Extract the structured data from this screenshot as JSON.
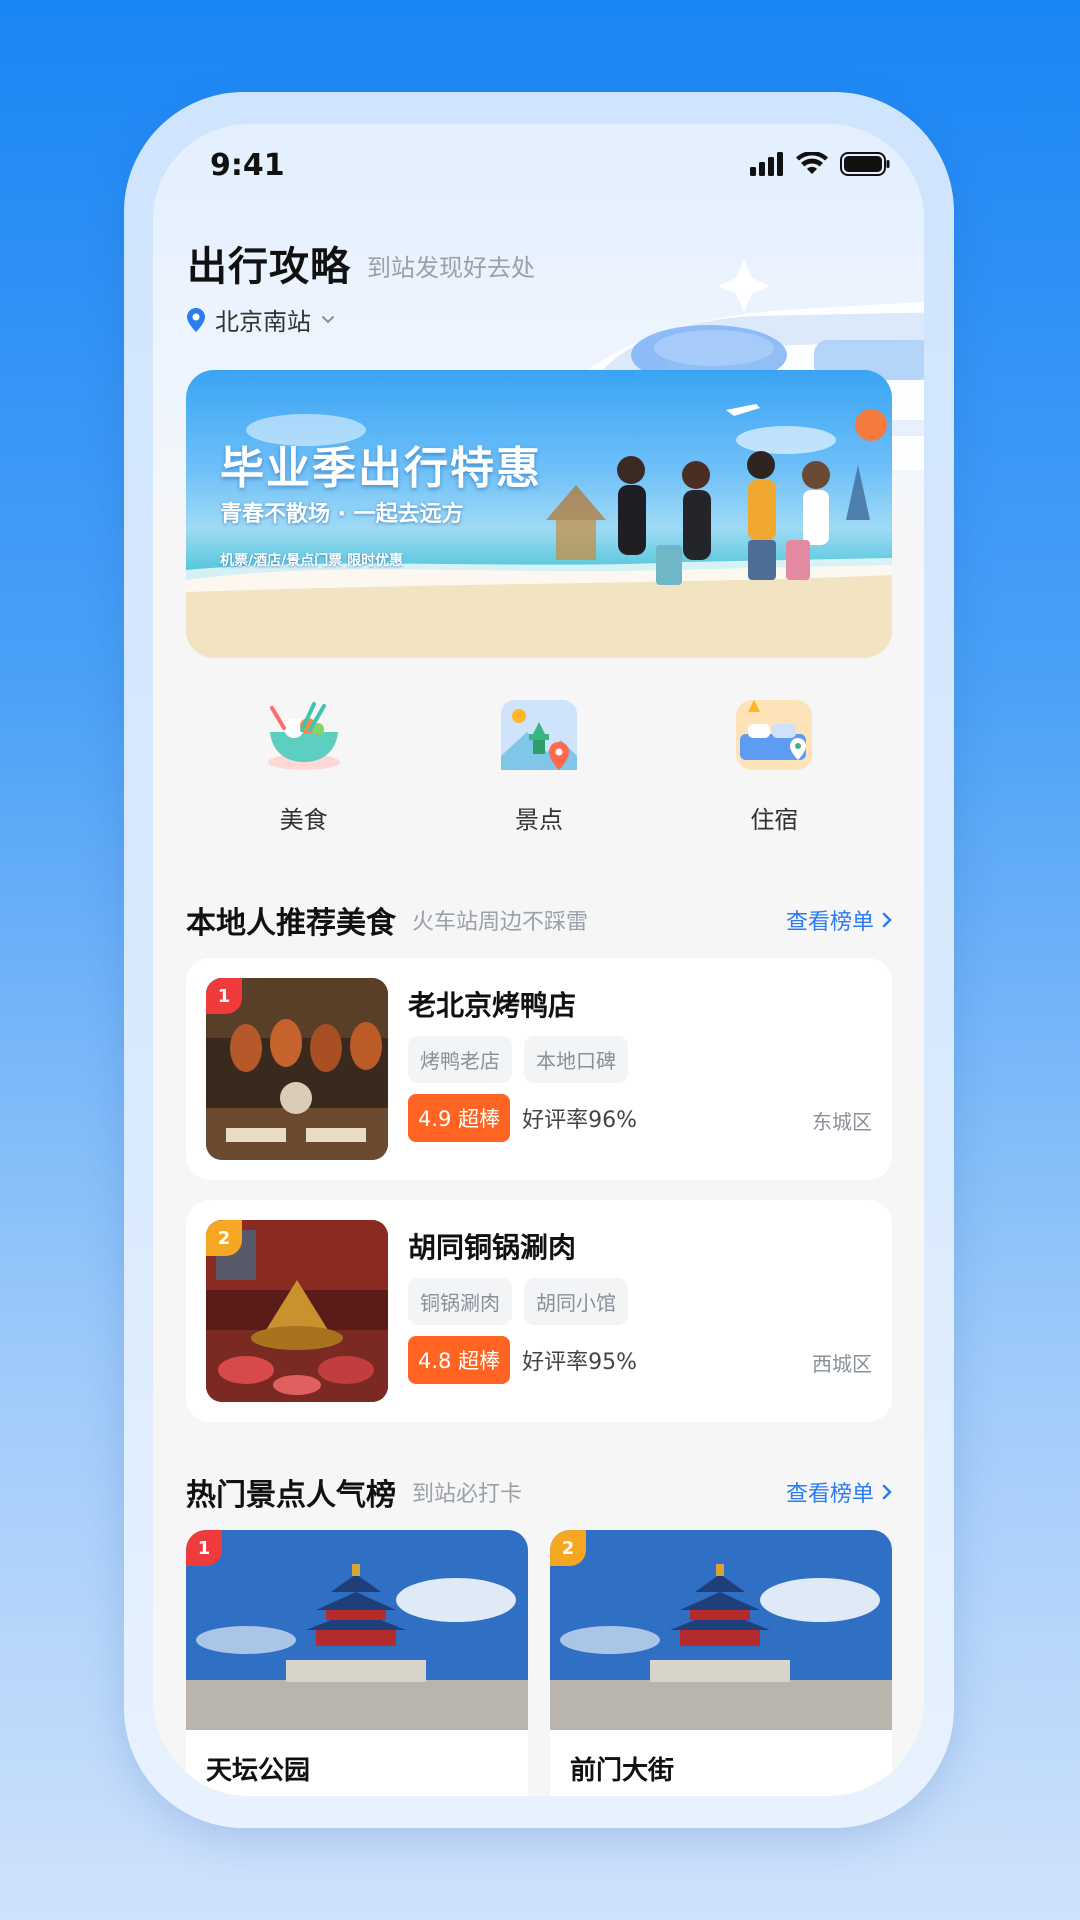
{
  "status_bar": {
    "time": "9:41"
  },
  "header": {
    "title": "出行攻略",
    "subtitle": "到站发现好去处",
    "location": "北京南站"
  },
  "banner": {
    "title": "毕业季出行特惠",
    "subtitle": "青春不散场 · 一起去远方",
    "tags": "机票/酒店/景点门票 限时优惠"
  },
  "categories": [
    {
      "label": "美食",
      "icon": "food-bowl-icon"
    },
    {
      "label": "景点",
      "icon": "scenic-spot-icon"
    },
    {
      "label": "住宿",
      "icon": "bed-hotel-icon"
    }
  ],
  "food_section": {
    "title": "本地人推荐美食",
    "subtitle": "火车站周边不踩雷",
    "more": "查看榜单",
    "items": [
      {
        "rank": "1",
        "name": "老北京烤鸭店",
        "tags": [
          "烤鸭老店",
          "本地口碑"
        ],
        "score": "4.9 超棒",
        "good_rate": "好评率96%",
        "district": "东城区"
      },
      {
        "rank": "2",
        "name": "胡同铜锅涮肉",
        "tags": [
          "铜锅涮肉",
          "胡同小馆"
        ],
        "score": "4.8 超棒",
        "good_rate": "好评率95%",
        "district": "西城区"
      }
    ]
  },
  "spot_section": {
    "title": "热门景点人气榜",
    "subtitle": "到站必打卡",
    "more": "查看榜单",
    "items": [
      {
        "rank": "1",
        "name": "天坛公园"
      },
      {
        "rank": "2",
        "name": "前门大街"
      }
    ]
  },
  "colors": {
    "accent_blue": "#2b7cf0",
    "score_orange": "#ff6422",
    "rank1_red": "#ef3b3b",
    "rank2_gold": "#f5a623"
  }
}
